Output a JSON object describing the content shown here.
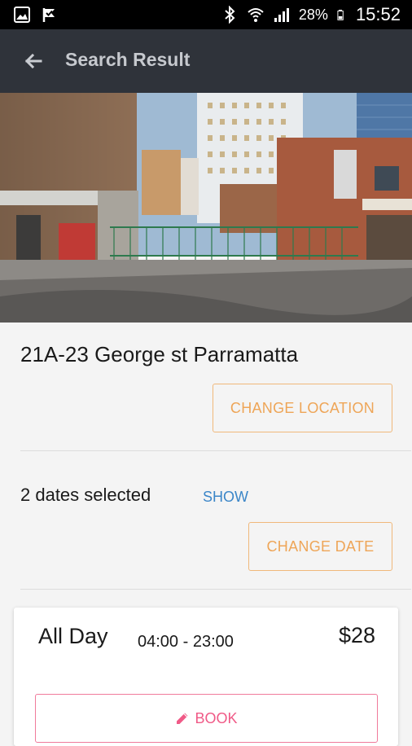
{
  "status_bar": {
    "battery": "28%",
    "time": "15:52",
    "icons": [
      "image-icon",
      "check-flag-icon",
      "bluetooth-icon",
      "wifi-icon",
      "signal-icon",
      "battery-icon"
    ]
  },
  "app_bar": {
    "title": "Search Result",
    "back_icon": "arrow-left-icon"
  },
  "location": {
    "address": "21A-23  George st Parramatta",
    "change_location_label": "CHANGE LOCATION"
  },
  "dates": {
    "summary": "2 dates selected",
    "show_label": "SHOW",
    "change_date_label": "CHANGE DATE"
  },
  "booking_option": {
    "label": "All Day",
    "hours": "04:00 - 23:00",
    "price": "$28",
    "book_label": "BOOK",
    "book_icon": "pencil-icon"
  },
  "colors": {
    "app_bar": "#2f333a",
    "accent_orange": "#eea557",
    "link_blue": "#3b86c8",
    "book_pink": "#f05a87"
  }
}
